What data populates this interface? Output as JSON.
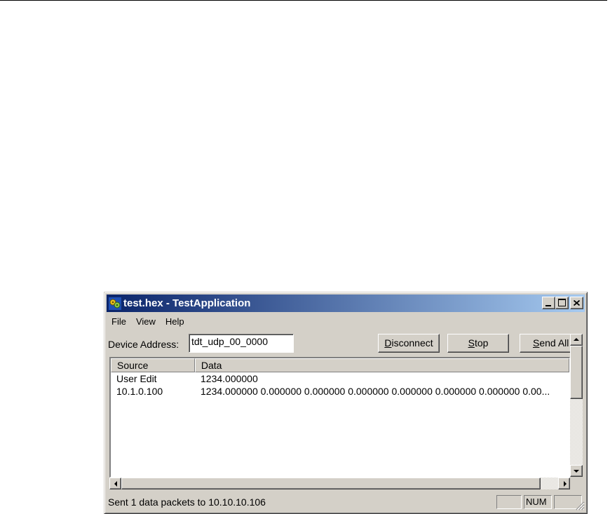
{
  "window": {
    "title": "test.hex - TestApplication"
  },
  "menu": {
    "items": [
      "File",
      "View",
      "Help"
    ]
  },
  "toolbar": {
    "device_label": "Device Address:",
    "device_value": "tdt_udp_00_0000",
    "buttons": [
      {
        "accel": "D",
        "rest": "isconnect"
      },
      {
        "accel": "S",
        "rest": "top"
      },
      {
        "accel": "S",
        "rest": "end All"
      }
    ]
  },
  "list": {
    "columns": [
      "Source",
      "Data"
    ],
    "rows": [
      {
        "source": "User Edit",
        "data": "1234.000000"
      },
      {
        "source": "10.1.0.100",
        "data": "1234.000000 0.000000 0.000000 0.000000 0.000000 0.000000 0.000000 0.00..."
      }
    ]
  },
  "status": {
    "message": "Sent 1 data packets to 10.10.10.106",
    "panes": [
      "",
      "NUM",
      ""
    ]
  },
  "colors": {
    "title_start": "#0a246a",
    "title_end": "#a6caf0",
    "face": "#d4d0c8"
  },
  "icons": [
    "app-icon",
    "minimize-icon",
    "maximize-icon",
    "close-icon",
    "scroll-up-arrow-icon",
    "scroll-down-arrow-icon",
    "scroll-left-arrow-icon",
    "scroll-right-arrow-icon",
    "size-grip-icon"
  ]
}
